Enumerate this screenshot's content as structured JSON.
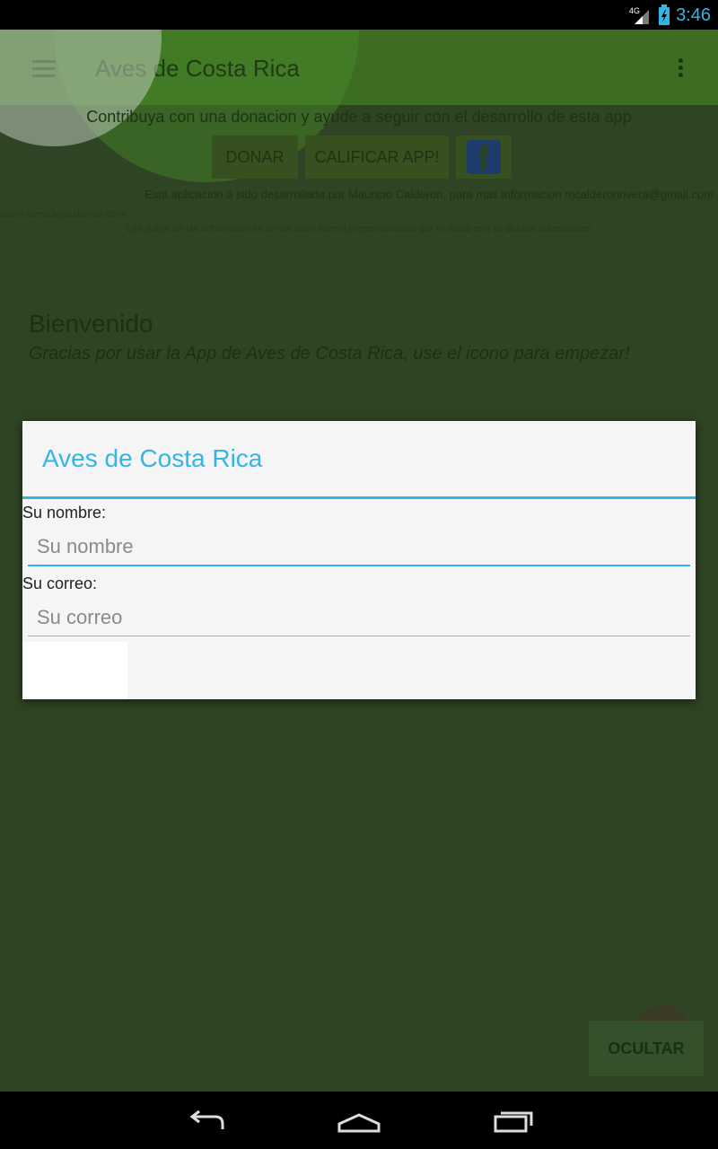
{
  "status_bar": {
    "network": "4G",
    "time": "3:46"
  },
  "toolbar": {
    "title": "Aves de Costa Rica",
    "menu_icon": "hamburger-menu-icon",
    "overflow_icon": "overflow-menu-icon"
  },
  "main": {
    "donate_text": "Contribuya con una donacion y ayude a seguir con el desarrollo de esta app",
    "donate_button": "DONAR",
    "rate_button": "CALIFICAR APP!",
    "facebook_icon": "facebook-icon",
    "developer_text": "Esta aplicacion a sido desarrollada por Mauricio Calderon, para mas informacion mcalderonrivera@gmail.com",
    "website_text": "www.avesdecostarica.com",
    "data_text": "Los datos de las informaciones de las aves fueron proporcionadas por el INBio con su debida autorizacion",
    "welcome_title": "Bienvenido",
    "welcome_subtitle": "Gracias por usar la App de Aves de Costa Rica, use el icono para empezar!",
    "hide_button": "OCULTAR"
  },
  "dialog": {
    "title": "Aves de Costa Rica",
    "name_label": "Su nombre:",
    "name_placeholder": "Su nombre",
    "name_value": "",
    "email_label": "Su correo:",
    "email_placeholder": "Su correo",
    "email_value": ""
  },
  "nav_bar": {
    "back_icon": "back-icon",
    "home_icon": "home-icon",
    "recents_icon": "recent-apps-icon"
  },
  "colors": {
    "accent": "#33b5e5",
    "app_background_dimmed": "#2f4424",
    "toolbar_dimmed": "#3c6d23",
    "dialog_background": "#f5f5f5"
  }
}
